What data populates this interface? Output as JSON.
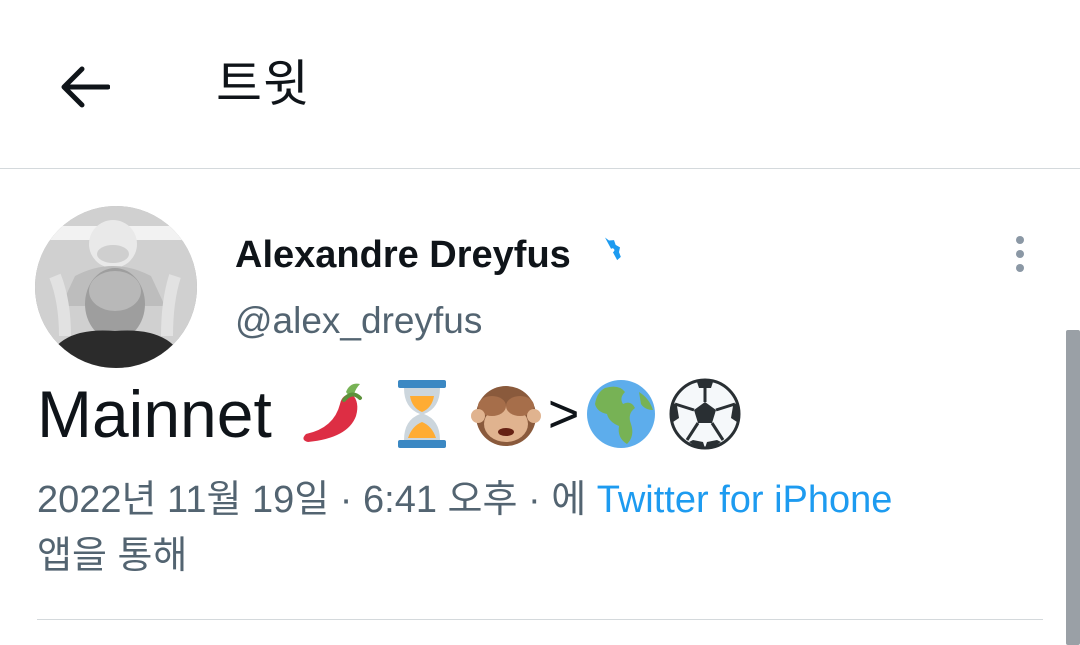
{
  "header": {
    "title": "트윗",
    "back_icon": "arrow-left-icon"
  },
  "author": {
    "name": "Alexandre Dreyfus",
    "handle": "@alex_dreyfus",
    "verified_icon": "verified-badge-icon",
    "verified_color": "#1d9bf0"
  },
  "tweet": {
    "text": "Mainnet",
    "emojis": [
      "hot-pepper-icon",
      "hourglass-icon",
      "see-no-evil-monkey-icon"
    ],
    "gt": ">",
    "trailing_emojis": [
      "globe-europe-africa-icon",
      "soccer-ball-icon"
    ]
  },
  "meta": {
    "timestamp": "2022년 11월 19일 · 6:41 오후 · 에",
    "source": "Twitter for iPhone",
    "suffix": "앱을 통해"
  },
  "colors": {
    "link": "#1d9bf0",
    "secondary_text": "#536471",
    "divider": "#d4d9dc"
  }
}
